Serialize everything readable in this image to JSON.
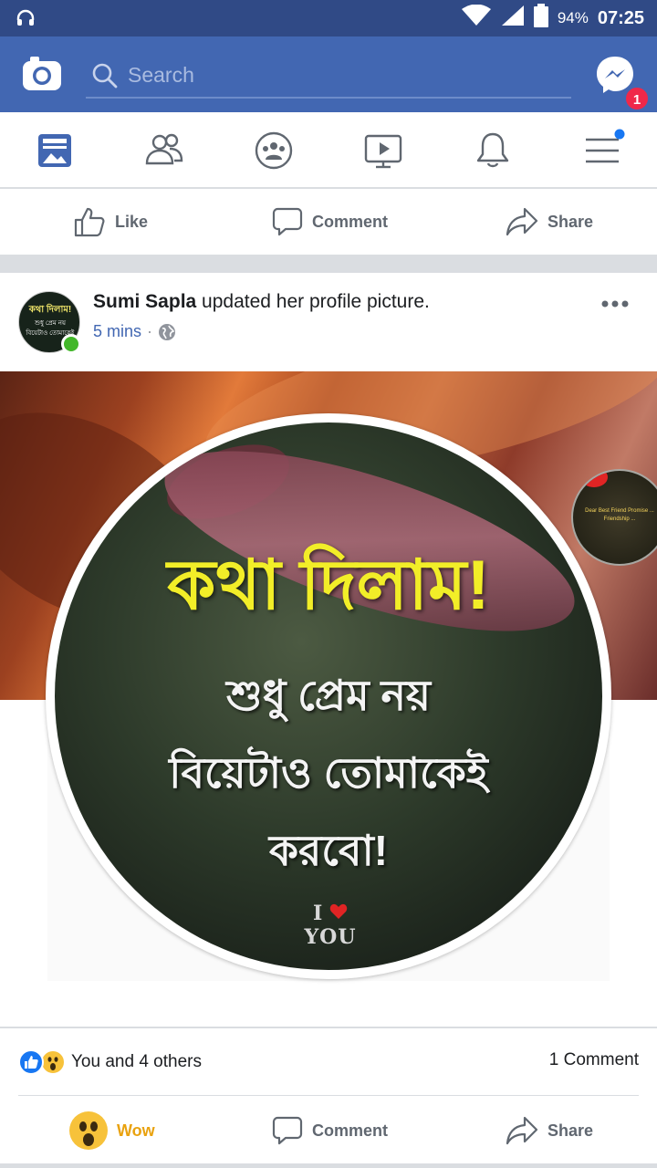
{
  "status_bar": {
    "battery": "94%",
    "time": "07:25"
  },
  "header": {
    "search_placeholder": "Search",
    "messenger_badge": "1"
  },
  "prev_post_actions": {
    "like": "Like",
    "comment": "Comment",
    "share": "Share"
  },
  "post": {
    "author": "Sumi Sapla",
    "action": " updated her profile picture.",
    "time": "5 mins",
    "separator": "·",
    "avatar_text": {
      "line1": "কথা দিলাম!",
      "line2": "শুধু প্রেম নয়",
      "line3": "বিয়েটাও তোমাকেই"
    },
    "image_text": {
      "line1": "কথা দিলাম!",
      "line2": "শুধু প্রেম নয়",
      "line3": "বিয়েটাও তোমাকেই",
      "line4": "করবো!",
      "love_i": "I",
      "love_you": "YOU"
    },
    "peek_text": "Dear Best Friend Promise ... Friendship ...",
    "reactions_text": "You and 4 others",
    "comments_count": "1 Comment",
    "actions": {
      "wow": "Wow",
      "comment": "Comment",
      "share": "Share"
    }
  },
  "colors": {
    "brand": "#4267b2",
    "status_bar": "#304a86",
    "wow": "#f7b928",
    "link": "#4267b2"
  }
}
